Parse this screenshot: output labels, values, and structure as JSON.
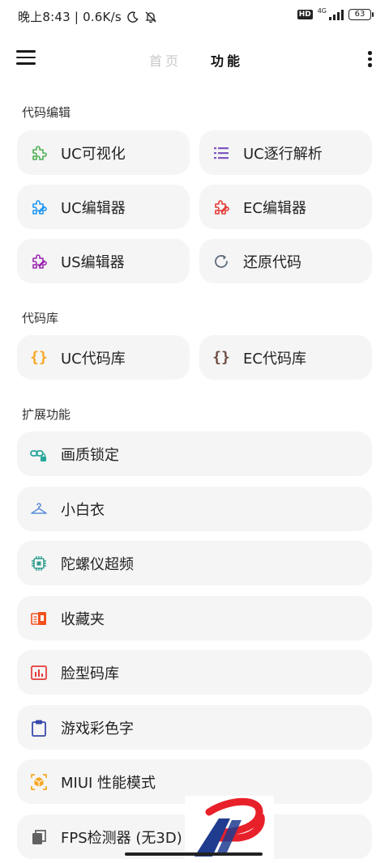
{
  "status_bar": {
    "left_text": "晚上8:43 | 0.6K/s",
    "hd_badge": "HD",
    "network": "4G",
    "battery": "63"
  },
  "app_bar": {
    "tabs": [
      "首页",
      "功能"
    ],
    "active_tab": "功能"
  },
  "sections": {
    "code_edit": {
      "title": "代码编辑",
      "items": [
        {
          "label": "UC可视化",
          "icon": "puzzle-icon",
          "color": "#4caf50"
        },
        {
          "label": "UC逐行解析",
          "icon": "list-icon",
          "color": "#7e57c2"
        },
        {
          "label": "UC编辑器",
          "icon": "puzzle-edit-icon",
          "color": "#2196f3"
        },
        {
          "label": "EC编辑器",
          "icon": "puzzle-edit-icon",
          "color": "#e53935"
        },
        {
          "label": "US编辑器",
          "icon": "puzzle-edit-icon",
          "color": "#9c27b0"
        },
        {
          "label": "还原代码",
          "icon": "restore-icon",
          "color": "#5f6b7a"
        }
      ]
    },
    "code_lib": {
      "title": "代码库",
      "items": [
        {
          "label": "UC代码库",
          "icon": "braces-icon",
          "color": "#f5a623"
        },
        {
          "label": "EC代码库",
          "icon": "braces-icon",
          "color": "#6d4c41"
        }
      ]
    },
    "extensions": {
      "title": "扩展功能",
      "items": [
        {
          "label": "画质锁定",
          "icon": "link-lock-icon",
          "color": "#26a69a"
        },
        {
          "label": "小白衣",
          "icon": "hanger-icon",
          "color": "#5c8fd6"
        },
        {
          "label": "陀螺仪超频",
          "icon": "chip-icon",
          "color": "#2e9e8f"
        },
        {
          "label": "收藏夹",
          "icon": "collection-icon",
          "color": "#f4511e"
        },
        {
          "label": "脸型码库",
          "icon": "bar-chart-icon",
          "color": "#e53935"
        },
        {
          "label": "游戏彩色字",
          "icon": "clipboard-icon",
          "color": "#3949ab"
        },
        {
          "label": "MIUI 性能模式",
          "icon": "cube-icon",
          "color": "#f5a623"
        },
        {
          "label": "FPS检测器 (无3D)",
          "icon": "copy-icon",
          "color": "#616161"
        }
      ]
    }
  }
}
